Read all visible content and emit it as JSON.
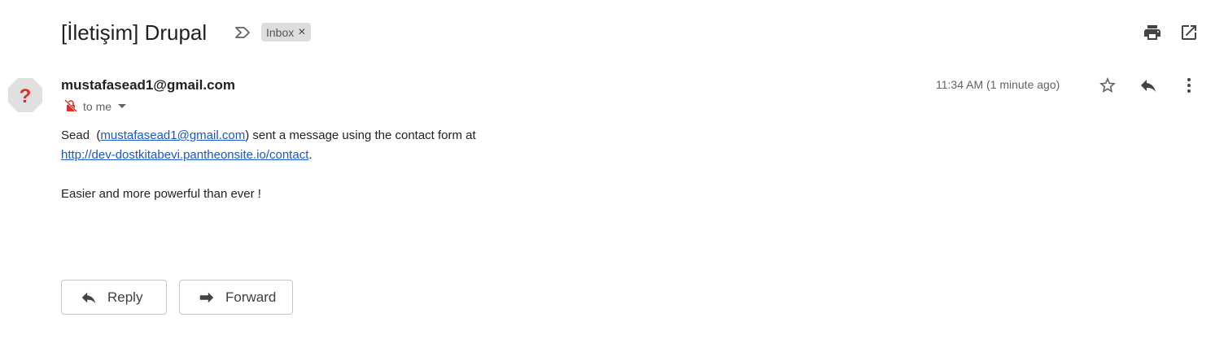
{
  "subject": "[İletişim] Drupal",
  "label": {
    "name": "Inbox",
    "remove": "×"
  },
  "sender": {
    "email": "mustafasead1@gmail.com",
    "recipient": "to me",
    "avatar_glyph": "?"
  },
  "timestamp": "11:34 AM (1 minute ago)",
  "body": {
    "name": "Sead",
    "email_link": "mustafasead1@gmail.com",
    "after_email": ") sent a message using the contact form at",
    "url": "http://dev-dostkitabevi.pantheonsite.io/contact",
    "url_suffix": ".",
    "message": "Easier and more powerful than ever !"
  },
  "buttons": {
    "reply": "Reply",
    "forward": "Forward"
  },
  "icons": {
    "important": "important-marker-icon",
    "print": "print-icon",
    "new_window": "open-in-new-window-icon",
    "star": "star-icon",
    "reply": "reply-icon",
    "more": "more-vertical-icon",
    "unencrypted": "unencrypted-lock-icon",
    "dropdown": "chevron-down-icon",
    "avatar": "unknown-sender-avatar"
  },
  "colors": {
    "link": "#1a57c7",
    "avatar_bg": "#e0e0e0",
    "avatar_glyph": "#d93025",
    "unencrypted": "#d93025",
    "chip_bg": "#dddddd"
  }
}
